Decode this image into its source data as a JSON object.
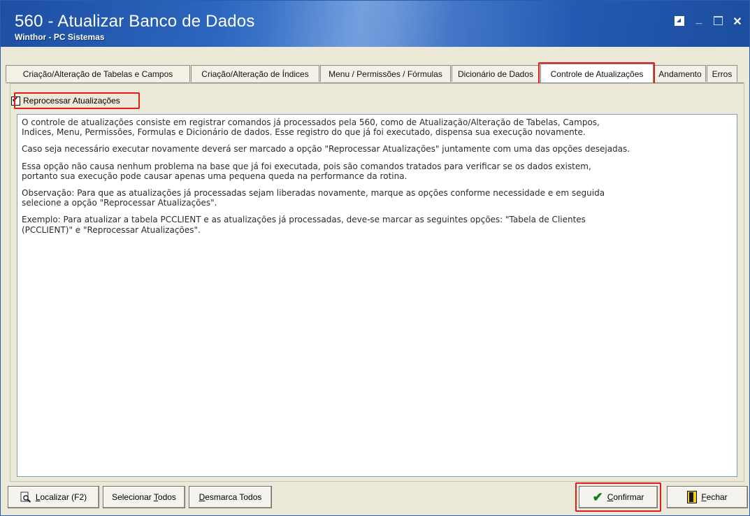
{
  "window": {
    "title": "560 - Atualizar Banco de Dados",
    "subtitle": "Winthor - PC Sistemas",
    "controls": [
      "restore-icon",
      "minimize-icon",
      "maximize-icon",
      "close-icon"
    ]
  },
  "tabs": [
    {
      "label": "Criação/Alteração de Tabelas e Campos",
      "active": false
    },
    {
      "label": "Criação/Alteração de Índices",
      "active": false
    },
    {
      "label": "Menu / Permissões / Fórmulas",
      "active": false
    },
    {
      "label": "Dicionário de Dados",
      "active": false
    },
    {
      "label": "Controle de Atualizações",
      "active": true
    },
    {
      "label": "Andamento",
      "active": false
    },
    {
      "label": "Erros",
      "active": false
    }
  ],
  "checkbox": {
    "label": "Reprocessar Atualizações",
    "checked": true
  },
  "memo": {
    "paragraphs": [
      "O controle de atualizações consiste em registrar comandos já processados pela 560, como de Atualização/Alteração de Tabelas, Campos,\nIndices, Menu, Permissões, Formulas e Dicionário de dados. Esse registro do que já foi executado, dispensa sua execução novamente.",
      "Caso seja necessário executar novamente deverá ser marcado a opção \"Reprocessar Atualizações\" juntamente com uma das opções desejadas.",
      "Essa opção não causa nenhum problema na base que já foi executada, pois são comandos tratados para verificar se os dados existem,\nportanto sua execução pode causar apenas uma pequena queda na performance da rotina.",
      "Observação: Para que as atualizações já processadas sejam liberadas novamente, marque as opções conforme necessidade e em seguida\nselecione a opção \"Reprocessar Atualizações\".",
      "Exemplo: Para atualizar a tabela PCCLIENT e as atualizações já processadas, deve-se marcar as seguintes opções: \"Tabela de Clientes\n(PCCLIENT)\" e \"Reprocessar Atualizações\"."
    ]
  },
  "buttons": {
    "localizar": {
      "pre": "",
      "u": "L",
      "post": "ocalizar (F2)"
    },
    "selecionar": {
      "pre": "Selecionar ",
      "u": "T",
      "post": "odos"
    },
    "desmarca": {
      "pre": "",
      "u": "D",
      "post": "esmarca Todos"
    },
    "confirmar": {
      "pre": "",
      "u": "C",
      "post": "onfirmar"
    },
    "fechar": {
      "pre": "",
      "u": "F",
      "post": "echar"
    }
  },
  "colors": {
    "highlight": "#e21b1b",
    "title_bar": "#1d4fa3"
  }
}
